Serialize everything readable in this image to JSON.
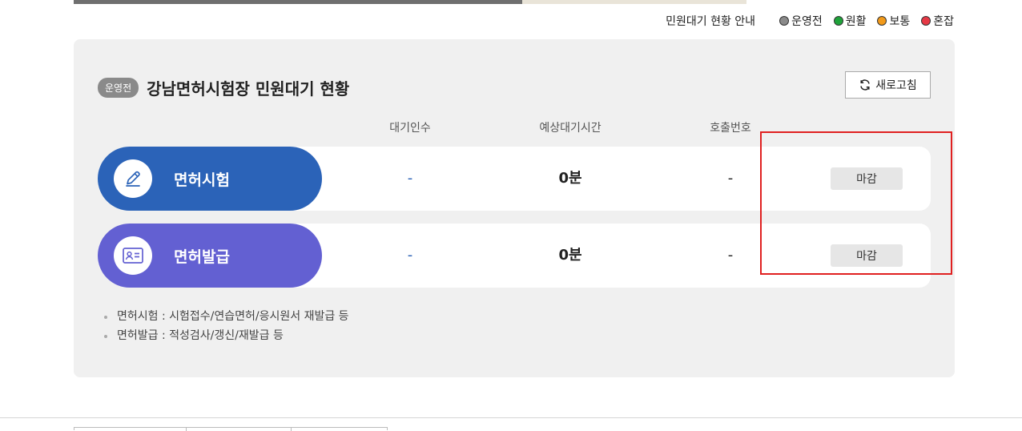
{
  "legend": {
    "title": "민원대기 현황 안내",
    "items": [
      {
        "label": "운영전",
        "color": "#8a8a8a"
      },
      {
        "label": "원활",
        "color": "#1fa33a"
      },
      {
        "label": "보통",
        "color": "#f29a1a"
      },
      {
        "label": "혼잡",
        "color": "#e63946"
      }
    ]
  },
  "panel": {
    "status_pill": "운영전",
    "title": "강남면허시험장 민원대기 현황",
    "refresh_label": "새로고침",
    "columns": {
      "waiting": "대기인수",
      "expected_time": "예상대기시간",
      "call_number": "호출번호"
    },
    "rows": [
      {
        "label": "면허시험",
        "icon": "pencil-icon",
        "color": "#2b63b8",
        "waiting": "-",
        "expected_time": "0분",
        "call_number": "-",
        "status": "마감"
      },
      {
        "label": "면허발급",
        "icon": "id-card-icon",
        "color": "#6360d2",
        "waiting": "-",
        "expected_time": "0분",
        "call_number": "-",
        "status": "마감"
      }
    ],
    "notes": [
      "면허시험 : 시험접수/연습면허/응시원서 재발급 등",
      "면허발급 : 적성검사/갱신/재발급 등"
    ]
  }
}
